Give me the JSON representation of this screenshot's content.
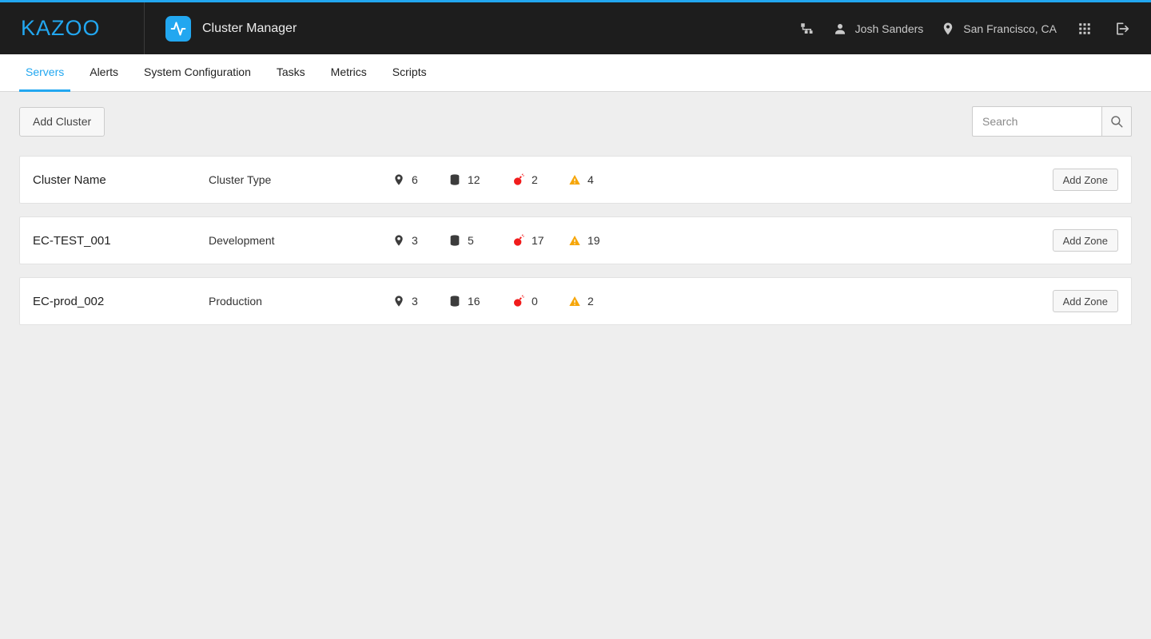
{
  "colors": {
    "accent": "#22a7f0"
  },
  "header": {
    "brand": "KAZOO",
    "app_title": "Cluster Manager",
    "user_name": "Josh Sanders",
    "location": "San Francisco, CA"
  },
  "tabs": [
    {
      "label": "Servers",
      "active": true
    },
    {
      "label": "Alerts",
      "active": false
    },
    {
      "label": "System Configuration",
      "active": false
    },
    {
      "label": "Tasks",
      "active": false
    },
    {
      "label": "Metrics",
      "active": false
    },
    {
      "label": "Scripts",
      "active": false
    }
  ],
  "toolbar": {
    "add_cluster_label": "Add Cluster",
    "search_placeholder": "Search"
  },
  "cluster_table": {
    "header": {
      "name": "Cluster Name",
      "type": "Cluster Type"
    },
    "add_zone_label": "Add Zone",
    "rows": [
      {
        "name": "Cluster Name",
        "type": "Cluster Type",
        "zones": 6,
        "servers": 12,
        "critical": 2,
        "warnings": 4,
        "is_header": true
      },
      {
        "name": "EC-TEST_001",
        "type": "Development",
        "zones": 3,
        "servers": 5,
        "critical": 17,
        "warnings": 19,
        "is_header": false
      },
      {
        "name": "EC-prod_002",
        "type": "Production",
        "zones": 3,
        "servers": 16,
        "critical": 0,
        "warnings": 2,
        "is_header": false
      }
    ]
  }
}
